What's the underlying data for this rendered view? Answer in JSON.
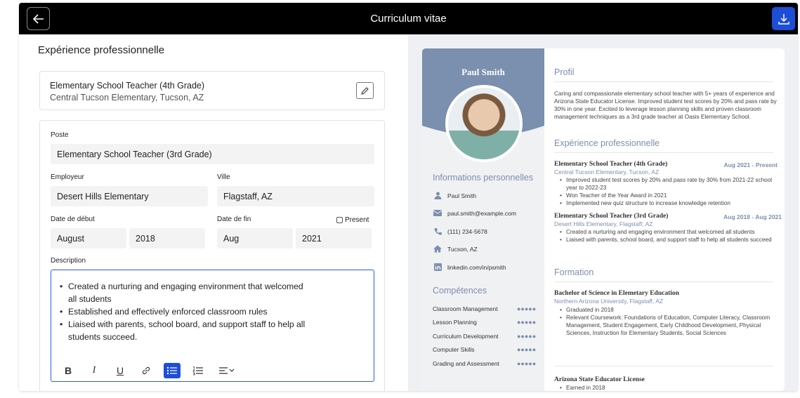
{
  "window": {
    "title": "Curriculum vitae"
  },
  "form": {
    "section_title": "Expérience professionnelle",
    "existing": {
      "title": "Elementary School Teacher (4th Grade)",
      "subtitle": "Central Tucson Elementary, Tucson, AZ"
    },
    "poste_label": "Poste",
    "poste_value": "Elementary School Teacher (3rd Grade)",
    "employeur_label": "Employeur",
    "employeur_value": "Desert Hills Elementary",
    "ville_label": "Ville",
    "ville_value": "Flagstaff, AZ",
    "debut_label": "Date de début",
    "debut_month": "August",
    "debut_year": "2018",
    "fin_label": "Date de fin",
    "fin_month": "Aug",
    "fin_year": "2021",
    "present_label": "Present",
    "description_label": "Description",
    "description_items": [
      "Created a nurturing and engaging environment that welcomed all students",
      "Established and effectively enforced classroom rules",
      "Liaised with parents, school board, and support staff to help all students succeed."
    ],
    "toolbar": {
      "bold": "B",
      "italic": "I",
      "underline": "U"
    }
  },
  "resume": {
    "name": "Paul Smith",
    "info_title": "Informations personnelles",
    "info": [
      {
        "icon": "person-icon",
        "text": "Paul Smith"
      },
      {
        "icon": "mail-icon",
        "text": "paul.smith@example.com"
      },
      {
        "icon": "phone-icon",
        "text": "(111) 234-5678"
      },
      {
        "icon": "home-icon",
        "text": "Tucson, AZ"
      },
      {
        "icon": "linkedin-icon",
        "text": "linkedin.com/in/psmith"
      }
    ],
    "skills_title": "Compétences",
    "skills": [
      {
        "name": "Classroom Management",
        "level": 5
      },
      {
        "name": "Lesson Planning",
        "level": 5
      },
      {
        "name": "Curriculum Development",
        "level": 5
      },
      {
        "name": "Computer Skills",
        "level": 5
      },
      {
        "name": "Grading and Assessment",
        "level": 5
      }
    ],
    "profile_title": "Profil",
    "profile_text": "Caring and compassionate elementary school teacher with 5+ years of experience and Arizona State Educator License. Improved student test scores by 20% and pass rate by 30% in one year. Excited to leverage lesson planning skills and proven classroom management techniques as a 3rd grade teacher at Oasis Elementary School.",
    "exp_title": "Expérience professionnelle",
    "jobs": [
      {
        "title": "Elementary School Teacher (4th Grade)",
        "dates": "Aug 2021 - Present",
        "employer": "Central Tucson Elementary, Tucson, AZ",
        "bullets": [
          "Improved student test scores by 20% and pass rate by 30% from 2021-22 school year to 2022-23",
          "Won Teacher of the Year Award in 2021",
          "Implemented new quiz structure to increase knowledge retention"
        ]
      },
      {
        "title": "Elementary School Teacher (3rd Grade)",
        "dates": "Aug 2018 - Aug 2021",
        "employer": "Desert Hills Elementary, Flagstaff, AZ",
        "bullets": [
          "Created a nurturing and engaging environment that welcomed all students",
          "Liaised with parents, school board, and support staff to help all students succeed"
        ]
      }
    ],
    "edu_title": "Formation",
    "edu": {
      "degree": "Bachelor of Science in Elemetary Education",
      "school": "Northern Arizona University, Flagstaff, AZ",
      "bullets": [
        "Graduated in 2018",
        "Relevant Coursework: Foundations of Education, Computer Literacy, Classroom Management, Student Engagement, Early Childhood Development, Physical Sciences, Instruction for Elementary Students, Social Sciences"
      ]
    },
    "license": {
      "title": "Arizona State Educator License",
      "bullets": [
        "Earned in 2018"
      ]
    }
  }
}
